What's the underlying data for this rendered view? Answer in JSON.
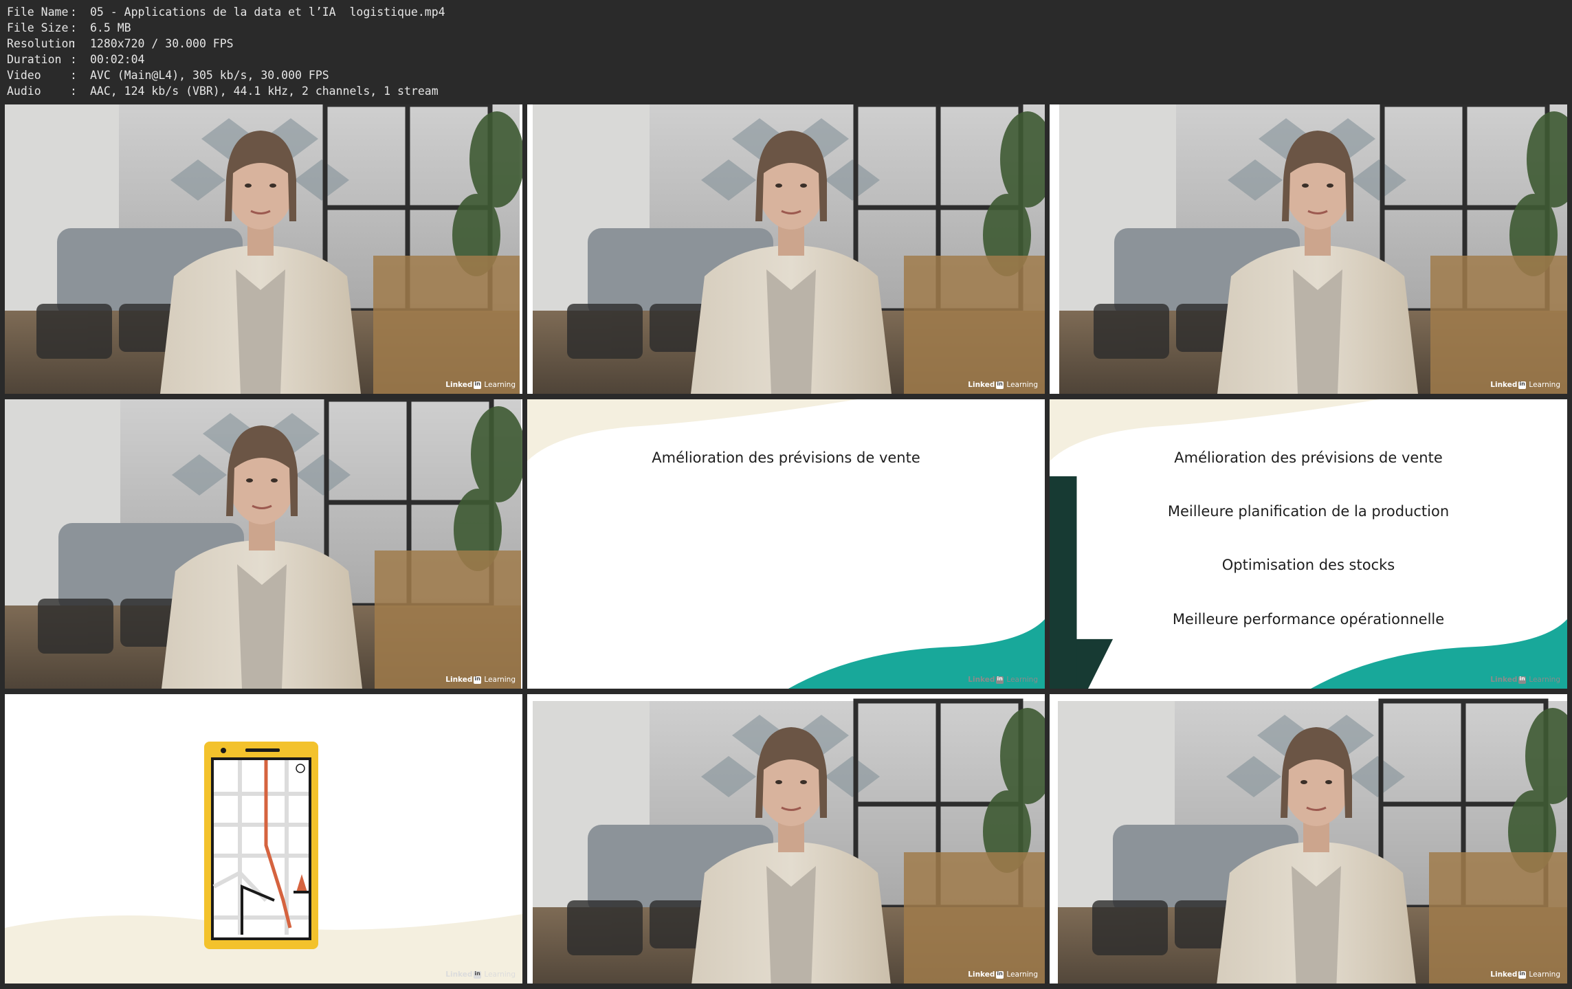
{
  "file_info": {
    "rows": [
      {
        "label": "File Name",
        "sep": ":",
        "value": "05 - Applications de la data et l’IA  logistique.mp4"
      },
      {
        "label": "File Size",
        "sep": ":",
        "value": "6.5 MB"
      },
      {
        "label": "Resolution",
        "sep": ":",
        "value": "1280x720 / 30.000 FPS"
      },
      {
        "label": "Duration",
        "sep": ":",
        "value": "00:02:04"
      },
      {
        "label": "Video",
        "sep": ":",
        "value": "AVC (Main@L4), 305 kb/s, 30.000 FPS"
      },
      {
        "label": "Audio",
        "sep": ":",
        "value": "AAC, 124 kb/s (VBR), 44.1 kHz, 2 channels, 1 stream"
      }
    ]
  },
  "watermark": {
    "linked": "Linked",
    "learning": "Learning"
  },
  "slides": {
    "single_title": "Amélioration des prévisions de vente",
    "flow": [
      "Amélioration des prévisions de vente",
      "Meilleure planification de la production",
      "Optimisation des stocks",
      "Meilleure performance opérationnelle"
    ]
  },
  "colors": {
    "background": "#2a2a2a",
    "teal": "#18a89a",
    "cream": "#f4efdf",
    "phone_yellow": "#f3c22c",
    "route_orange": "#d5633f"
  }
}
